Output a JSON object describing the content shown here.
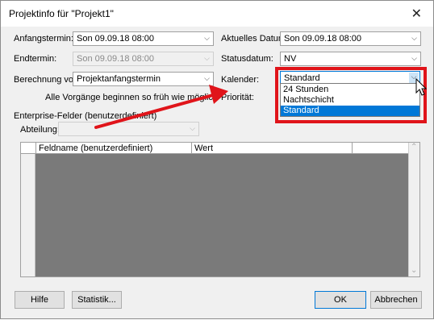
{
  "window": {
    "title": "Projektinfo für \"Projekt1\"",
    "close_glyph": "✕"
  },
  "fields": {
    "start_label": "Anfangstermin:",
    "start_value": "Son 09.09.18 08:00",
    "current_date_label": "Aktuelles Datum:",
    "current_date_value": "Son 09.09.18 08:00",
    "end_label": "Endtermin:",
    "end_value": "Son 09.09.18 08:00",
    "status_date_label": "Statusdatum:",
    "status_date_value": "NV",
    "calc_label": "Berechnung vom:",
    "calc_value": "Projektanfangstermin",
    "calendar_label": "Kalender:",
    "calendar_value": "Standard",
    "calc_note": "Alle Vorgänge beginnen so früh wie möglich",
    "priority_label": "Priorität:"
  },
  "calendar_options": [
    "24 Stunden",
    "Nachtschicht",
    "Standard"
  ],
  "calendar_selected": "Standard",
  "enterprise": {
    "section_label": "Enterprise-Felder (benutzerdefiniert)",
    "department_label": "Abteilung:",
    "department_value": ""
  },
  "grid": {
    "col_field": "Feldname (benutzerdefiniert)",
    "col_value": "Wert"
  },
  "buttons": {
    "help": "Hilfe",
    "stats": "Statistik...",
    "ok": "OK",
    "cancel": "Abbrechen"
  },
  "colors": {
    "highlight": "#e0141a",
    "selection": "#0078d7"
  },
  "glyphs": {
    "dropdown_arrow": "⌵",
    "scroll_up": "⌃",
    "scroll_down": "⌄"
  }
}
